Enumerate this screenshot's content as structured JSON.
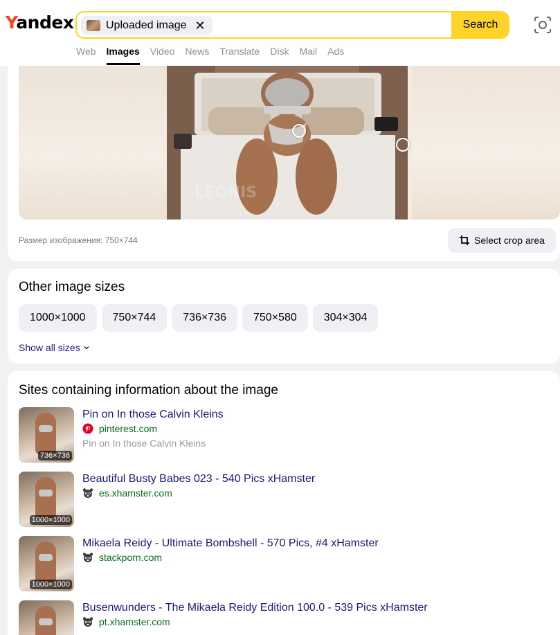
{
  "header": {
    "logo_y": "Y",
    "logo_rest": "andex",
    "chip_label": "Uploaded image",
    "chip_close": "✕",
    "search_label": "Search",
    "tabs": [
      {
        "label": "Web"
      },
      {
        "label": "Images",
        "active": true
      },
      {
        "label": "Video"
      },
      {
        "label": "News"
      },
      {
        "label": "Translate"
      },
      {
        "label": "Disk"
      },
      {
        "label": "Mail"
      },
      {
        "label": "Ads"
      }
    ]
  },
  "image_panel": {
    "size_note": "Размер изображения: 750×744",
    "crop_label": "Select crop area"
  },
  "sizes_panel": {
    "title": "Other image sizes",
    "sizes": [
      "1000×1000",
      "750×744",
      "736×736",
      "750×580",
      "304×304"
    ],
    "show_all": "Show all sizes"
  },
  "sites_panel": {
    "title": "Sites containing information about the image",
    "sites": [
      {
        "title": "Pin on In those Calvin Kleins",
        "domain": "pinterest.com",
        "description": "Pin on In those Calvin Kleins",
        "badge": "736×736",
        "favicon": "pinterest-icon"
      },
      {
        "title": "Beautiful Busty Babes 023 - 540 Pics xHamster",
        "domain": "es.xhamster.com",
        "badge": "1000×1000",
        "favicon": "raccoon-icon"
      },
      {
        "title": "Mikaela Reidy - Ultimate Bombshell - 570 Pics, #4 xHamster",
        "domain": "stackporn.com",
        "badge": "1000×1000",
        "favicon": "raccoon-icon"
      },
      {
        "title": "Busenwunders - The Mikaela Reidy Edition 100.0 - 539 Pics xHamster",
        "domain": "pt.xhamster.com",
        "badge": "",
        "favicon": "raccoon-icon"
      }
    ]
  },
  "colors": {
    "accent": "#fed42b",
    "logo_red": "#fc3f1d",
    "link": "#1a1a80",
    "domain_green": "#0b6b1a"
  }
}
